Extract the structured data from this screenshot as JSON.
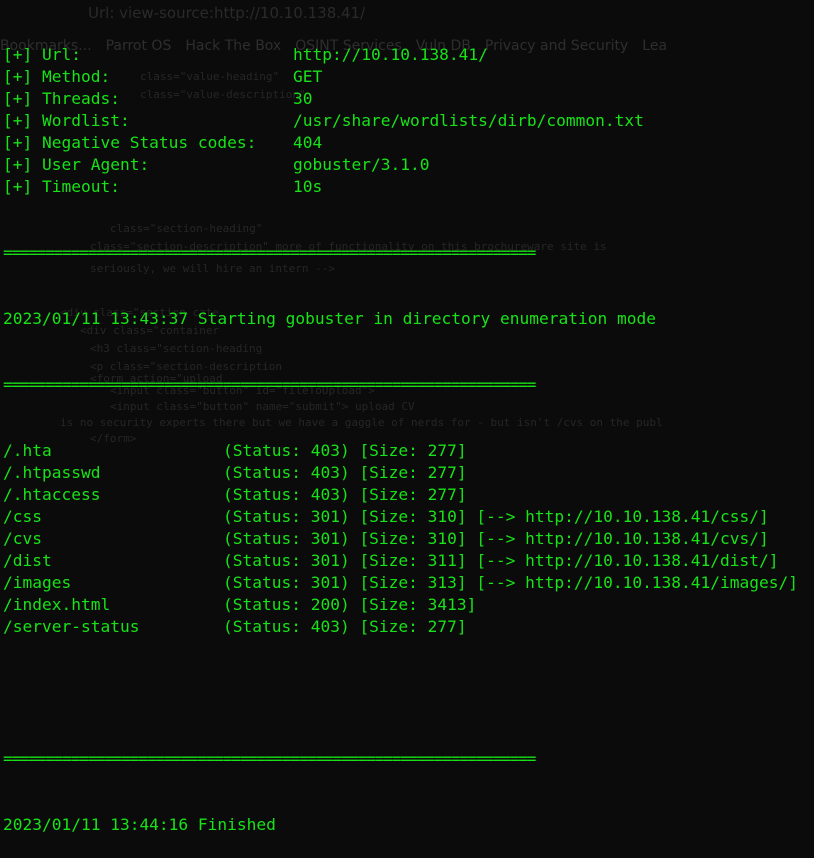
{
  "ghost": {
    "tab_text": "Url:  view-source:http://10.10.138.41/",
    "bookmarks": [
      "Bookmarks...",
      "Parrot OS",
      "Hack The Box",
      "OSINT Services",
      "Vuln DB",
      "Privacy and Security",
      "Lea"
    ],
    "source_lines": [
      "class=\"value-heading\"",
      "class=\"value-description\"",
      "class=\"section-heading\"",
      "class=\"section-description\" more of functionality on this brochureware site is",
      "seriously, we will hire an intern -->",
      "<div class=\"section cate",
      "<div class=\"container",
      "<h3 class=\"section-heading",
      "<p class=\"section-description",
      "<form action=\"upload",
      "<input class=\"button\" id=\"fileToUpload\">",
      "<input class=\"button\" name=\"submit\"> upload CV",
      "is no security experts there but we have a gaggle of nerds for - but isn't /cvs on the publ",
      "</form>"
    ]
  },
  "config": [
    {
      "key": "[+] Url:",
      "value": "http://10.10.138.41/"
    },
    {
      "key": "[+] Method:",
      "value": "GET"
    },
    {
      "key": "[+] Threads:",
      "value": "30"
    },
    {
      "key": "[+] Wordlist:",
      "value": "/usr/share/wordlists/dirb/common.txt"
    },
    {
      "key": "[+] Negative Status codes:",
      "value": "404"
    },
    {
      "key": "[+] User Agent:",
      "value": "gobuster/3.1.0"
    },
    {
      "key": "[+] Timeout:",
      "value": "10s"
    }
  ],
  "separator": "===============================================================",
  "start_line": "2023/01/11 13:43:37 Starting gobuster in directory enumeration mode",
  "results": [
    {
      "path": "/.hta",
      "info": "(Status: 403) [Size: 277]"
    },
    {
      "path": "/.htpasswd",
      "info": "(Status: 403) [Size: 277]"
    },
    {
      "path": "/.htaccess",
      "info": "(Status: 403) [Size: 277]"
    },
    {
      "path": "/css",
      "info": "(Status: 301) [Size: 310] [--> http://10.10.138.41/css/]"
    },
    {
      "path": "/cvs",
      "info": "(Status: 301) [Size: 310] [--> http://10.10.138.41/cvs/]"
    },
    {
      "path": "/dist",
      "info": "(Status: 301) [Size: 311] [--> http://10.10.138.41/dist/]"
    },
    {
      "path": "/images",
      "info": "(Status: 301) [Size: 313] [--> http://10.10.138.41/images/]"
    },
    {
      "path": "/index.html",
      "info": "(Status: 200) [Size: 3413]"
    },
    {
      "path": "/server-status",
      "info": "(Status: 403) [Size: 277]"
    }
  ],
  "finish_line": "2023/01/11 13:44:16 Finished",
  "colors": {
    "text": "#18e218",
    "background": "#0b0b0b"
  }
}
